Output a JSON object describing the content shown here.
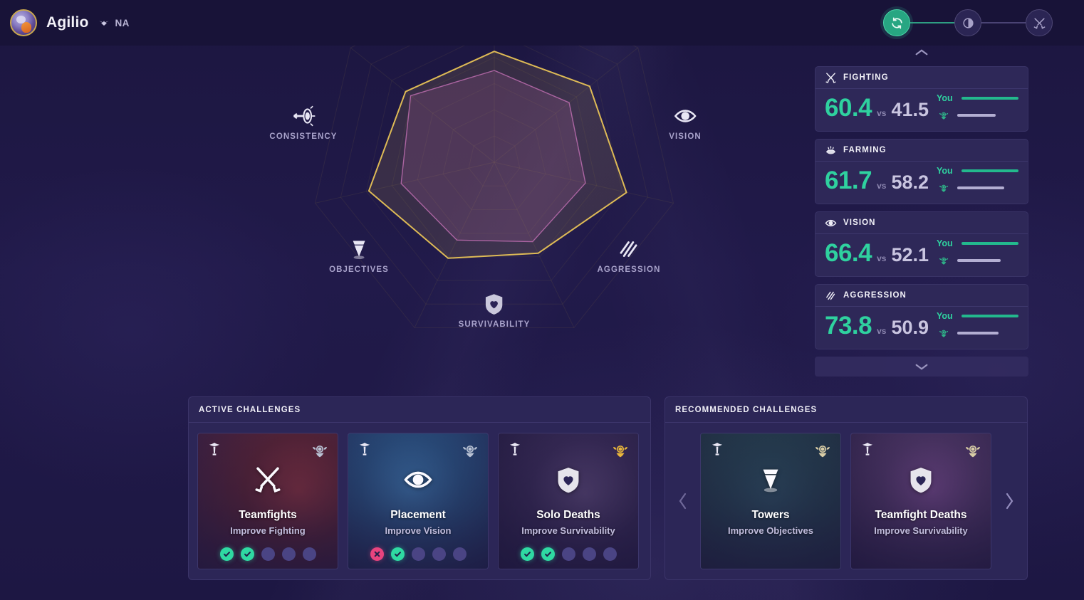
{
  "header": {
    "summoner_name": "Agilio",
    "region": "NA",
    "avatar_icon": "summoner-avatar-icon",
    "region_icon": "region-wings-icon",
    "stepper": [
      {
        "id": "step-overview",
        "icon": "refresh-icon",
        "state": "active"
      },
      {
        "id": "step-compare",
        "icon": "contrast-circle-icon",
        "state": "inactive"
      },
      {
        "id": "step-challenges",
        "icon": "crossed-blades-icon",
        "state": "inactive"
      }
    ]
  },
  "radar": {
    "axes": [
      {
        "key": "consistency",
        "label": "CONSISTENCY",
        "icon": "target-arrow-icon"
      },
      {
        "key": "vision",
        "label": "VISION",
        "icon": "eye-icon"
      },
      {
        "key": "objectives",
        "label": "OBJECTIVES",
        "icon": "tower-icon"
      },
      {
        "key": "aggression",
        "label": "AGGRESSION",
        "icon": "slash-marks-icon"
      },
      {
        "key": "survivability",
        "label": "SURVIVABILITY",
        "icon": "heart-shield-icon"
      }
    ],
    "series": [
      {
        "name": "you",
        "color": "#e8c356"
      },
      {
        "name": "average",
        "color": "#c470b5"
      }
    ]
  },
  "chart_data": {
    "type": "radar",
    "title": "",
    "categories": [
      "FIGHTING",
      "VISION",
      "AGGRESSION",
      "SURVIVABILITY",
      "OBJECTIVES",
      "CONSISTENCY",
      "FARMING"
    ],
    "series": [
      {
        "name": "You",
        "color": "#e8c356",
        "values": [
          60.4,
          66.4,
          73.8,
          55.0,
          58.0,
          70.0,
          61.7
        ]
      },
      {
        "name": "Average",
        "color": "#c470b5",
        "values": [
          50.0,
          52.1,
          50.9,
          48.0,
          47.0,
          52.0,
          58.2
        ]
      }
    ],
    "rlim": [
      0,
      100
    ],
    "rings": 7,
    "grid": true,
    "legend": false
  },
  "stats": {
    "scroll_up_icon": "chevron-up-icon",
    "scroll_down_icon": "chevron-down-icon",
    "you_label": "You",
    "vs_label": "vs",
    "rank_icon": "rank-emblem-icon",
    "accent_color": "#2fd19f",
    "cards": [
      {
        "key": "fighting",
        "title": "FIGHTING",
        "icon": "crossed-swords-icon",
        "you": "60.4",
        "them": "41.5",
        "you_pct": 100,
        "them_pct": 68
      },
      {
        "key": "farming",
        "title": "FARMING",
        "icon": "minion-coin-icon",
        "you": "61.7",
        "them": "58.2",
        "you_pct": 100,
        "them_pct": 82
      },
      {
        "key": "vision",
        "title": "VISION",
        "icon": "eye-icon",
        "you": "66.4",
        "them": "52.1",
        "you_pct": 100,
        "them_pct": 76
      },
      {
        "key": "aggression",
        "title": "AGGRESSION",
        "icon": "slash-marks-icon",
        "you": "73.8",
        "them": "50.9",
        "you_pct": 100,
        "them_pct": 72
      }
    ]
  },
  "active_challenges": {
    "title": "ACTIVE CHALLENGES",
    "cards": [
      {
        "name": "Teamfights",
        "goal": "Improve Fighting",
        "icon": "crossed-swords-icon",
        "art": "art-teamfights",
        "corner_left_icon": "challenge-token-icon",
        "badge_icon": "rank-emblem-icon",
        "badge_tier": "silver",
        "progress": [
          "pass",
          "pass",
          "empty",
          "empty",
          "empty"
        ]
      },
      {
        "name": "Placement",
        "goal": "Improve Vision",
        "icon": "eye-icon",
        "art": "art-placement",
        "corner_left_icon": "challenge-token-icon",
        "badge_icon": "rank-emblem-icon",
        "badge_tier": "silver",
        "progress": [
          "fail",
          "pass",
          "empty",
          "empty",
          "empty"
        ]
      },
      {
        "name": "Solo Deaths",
        "goal": "Improve Survivability",
        "icon": "heart-shield-icon",
        "art": "art-solodeaths",
        "corner_left_icon": "challenge-token-icon",
        "badge_icon": "rank-emblem-icon",
        "badge_tier": "gold",
        "progress": [
          "pass",
          "pass",
          "empty",
          "empty",
          "empty"
        ]
      }
    ]
  },
  "recommended_challenges": {
    "title": "RECOMMENDED CHALLENGES",
    "prev_icon": "chevron-left-icon",
    "next_icon": "chevron-right-icon",
    "cards": [
      {
        "name": "Towers",
        "goal": "Improve Objectives",
        "icon": "tower-icon",
        "art": "art-towers",
        "corner_left_icon": "challenge-token-icon",
        "badge_icon": "rank-emblem-icon",
        "badge_tier": "tan"
      },
      {
        "name": "Teamfight Deaths",
        "goal": "Improve Survivability",
        "icon": "heart-shield-icon",
        "art": "art-teamfightdeaths",
        "corner_left_icon": "challenge-token-icon",
        "badge_icon": "rank-emblem-icon",
        "badge_tier": "tan"
      }
    ]
  }
}
